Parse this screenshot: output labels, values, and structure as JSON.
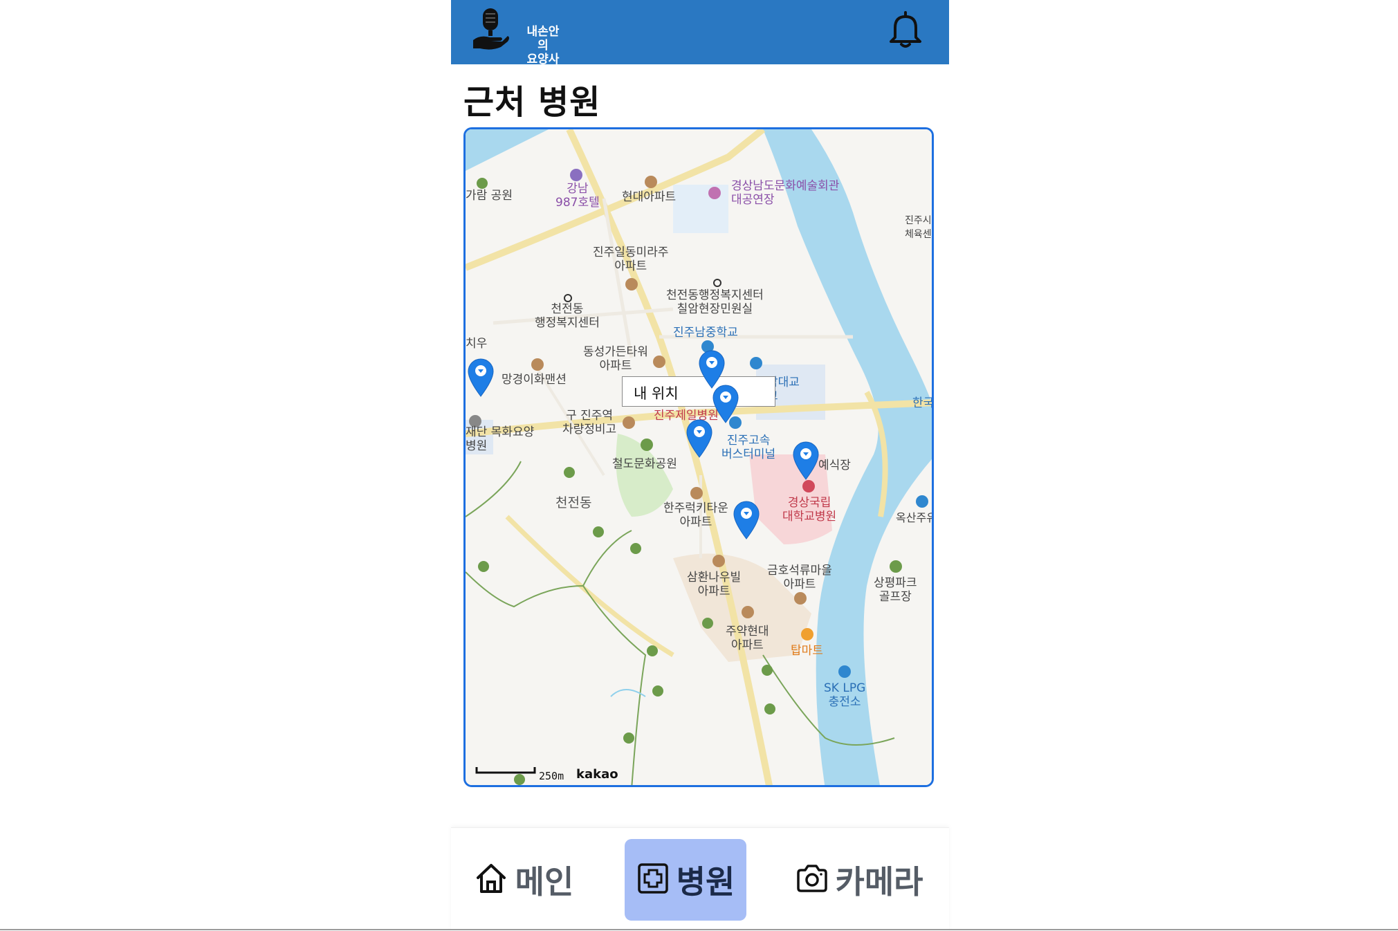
{
  "header": {
    "logo_text_line1": "내손안의",
    "logo_text_line2": "요양사",
    "bell_icon": "bell-icon"
  },
  "page_title": "근처 병원",
  "map": {
    "tooltip": "내 위치",
    "scale_text": "250m",
    "provider": "kakao",
    "colors": {
      "river": "#a9d8ee",
      "road": "#f2e3a6",
      "park": "#d7ecc9",
      "hospital_area": "#f7d6d8",
      "border": "#1d6fe0",
      "pin": "#1e7ee6"
    },
    "labels": {
      "l1": "가람 공원",
      "l2a": "강남",
      "l2b": "987호텔",
      "l3": "현대아파트",
      "l4a": "경상남도문화예술회관",
      "l4b": "대공연장",
      "l5a": "진주시",
      "l5b": "체육센",
      "l6a": "진주일동미라주",
      "l6b": "아파트",
      "l7a": "천전동행정복지센터",
      "l7b": "칠암현장민원실",
      "l8a": "천전동",
      "l8b": "행정복지센터",
      "l9": "진주남중학교",
      "l10a": "동성가든타워",
      "l10b": "아파트",
      "l11": "망경이화맨션",
      "l12a": "구 진주역",
      "l12b": "차량정비고",
      "l13": "진주제일병원",
      "l14a": "진주고속",
      "l14b": "버스터미널",
      "l15": "재단 목화요양",
      "l15b": "병원",
      "l16": "철도문화공원",
      "l17": "예식장",
      "l18a": "경상국립",
      "l18b": "대학교병원",
      "l19": "천전동",
      "l20a": "한주럭키타운",
      "l20b": "아파트",
      "l21a": "옥산주유",
      "l22a": "삼환나우빌",
      "l22b": "아파트",
      "l23a": "금호석류마을",
      "l23b": "아파트",
      "l24a": "상평파크",
      "l24b": "골프장",
      "l25a": "주약현대",
      "l25b": "아파트",
      "l26": "탑마트",
      "l27a": "SK LPG",
      "l27b": "충전소",
      "l28": "한국",
      "l29": "치우",
      "l30": "남대교",
      "l31": "교"
    }
  },
  "tabs": [
    {
      "label": "메인",
      "icon": "home-icon"
    },
    {
      "label": "병원",
      "icon": "hospital-plus-icon"
    },
    {
      "label": "카메라",
      "icon": "camera-icon"
    }
  ]
}
